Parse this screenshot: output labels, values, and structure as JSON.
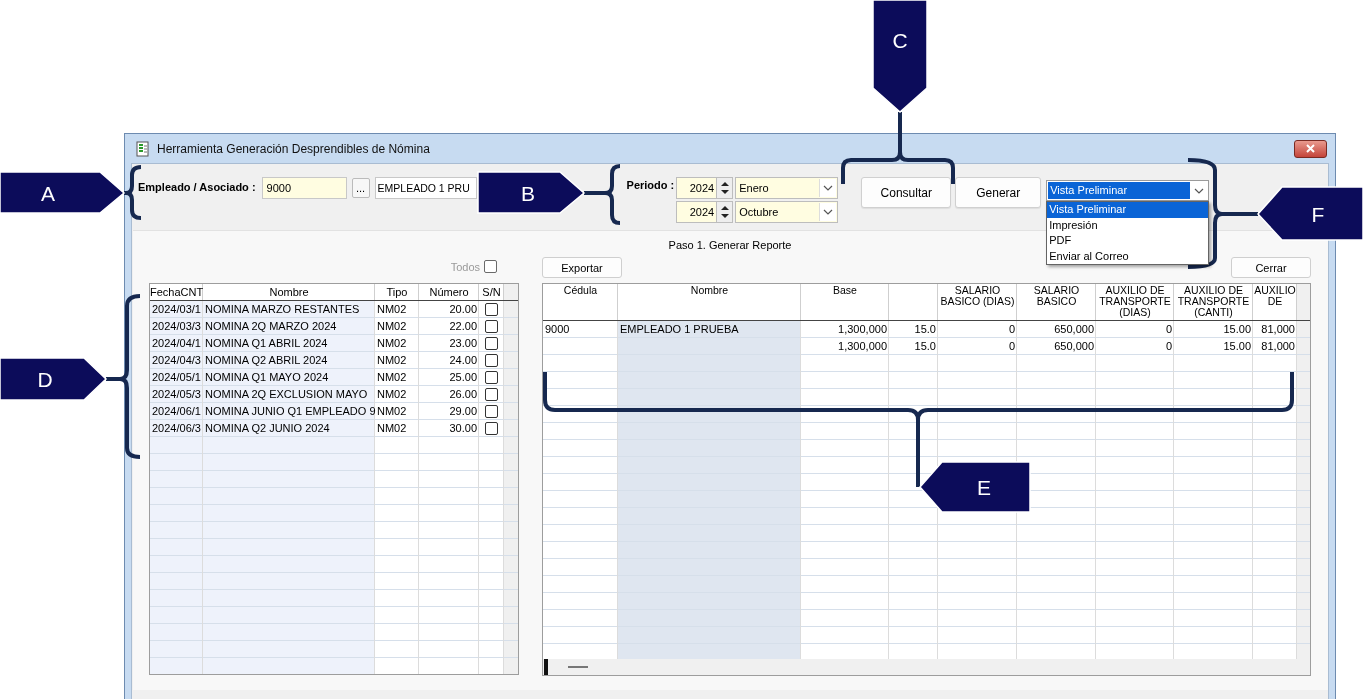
{
  "window": {
    "title": "Herramienta Generación Desprendibles de Nómina"
  },
  "employee": {
    "label": "Empleado / Asociado :",
    "code": "9000",
    "browse": "...",
    "name": "EMPLEADO 1 PRU"
  },
  "period": {
    "label": "Periodo :",
    "ranges": [
      {
        "year": "2024",
        "month": "Enero"
      },
      {
        "year": "2024",
        "month": "Octubre"
      }
    ]
  },
  "actions": [
    "Consultar",
    "Generar"
  ],
  "output": {
    "value": "Vista Preliminar",
    "expanded": true,
    "options": [
      {
        "label": "Vista Preliminar",
        "selected": true
      },
      {
        "label": "Impresión",
        "selected": false
      },
      {
        "label": "PDF",
        "selected": false
      },
      {
        "label": "Enviar al Correo",
        "selected": false
      }
    ]
  },
  "step_title": "Paso 1. Generar Reporte",
  "select_all": {
    "label": "Todos",
    "checked": false,
    "disabled": true
  },
  "export_button": "Exportar",
  "close_button": "Cerrar",
  "payrolls": {
    "columns": [
      {
        "label": "FechaCNT",
        "kind": "text"
      },
      {
        "label": "Nombre",
        "kind": "text"
      },
      {
        "label": "Tipo",
        "kind": "text"
      },
      {
        "label": "Número",
        "kind": "number"
      },
      {
        "label": "S/N",
        "kind": "check"
      }
    ],
    "rows": [
      {
        "cells": [
          "2024/03/1",
          "NOMINA MARZO RESTANTES",
          "NM02",
          "20.00"
        ],
        "checked": false
      },
      {
        "cells": [
          "2024/03/3",
          "NOMINA 2Q MARZO 2024",
          "NM02",
          "22.00"
        ],
        "checked": false
      },
      {
        "cells": [
          "2024/04/1",
          "NOMINA Q1 ABRIL 2024",
          "NM02",
          "23.00"
        ],
        "checked": false
      },
      {
        "cells": [
          "2024/04/3",
          "NOMINA Q2 ABRIL 2024",
          "NM02",
          "24.00"
        ],
        "checked": false
      },
      {
        "cells": [
          "2024/05/1",
          "NOMINA Q1 MAYO 2024",
          "NM02",
          "25.00"
        ],
        "checked": false
      },
      {
        "cells": [
          "2024/05/3",
          "NOMINA 2Q EXCLUSION MAYO",
          "NM02",
          "26.00"
        ],
        "checked": false
      },
      {
        "cells": [
          "2024/06/1",
          "NOMINA JUNIO Q1 EMPLEADO 9",
          "NM02",
          "29.00"
        ],
        "checked": false
      },
      {
        "cells": [
          "2024/06/3",
          "NOMINA Q2 JUNIO 2024",
          "NM02",
          "30.00"
        ],
        "checked": false
      }
    ]
  },
  "report": {
    "columns": [
      {
        "label": "Cédula",
        "kind": "text"
      },
      {
        "label": "Nombre",
        "kind": "text"
      },
      {
        "label": "Base",
        "kind": "number"
      },
      {
        "kind": "number"
      },
      {
        "label": "SALARIO BASICO (DIAS)",
        "kind": "number"
      },
      {
        "label": "SALARIO BASICO",
        "kind": "number"
      },
      {
        "label": "AUXILIO DE TRANSPORTE (DIAS)",
        "kind": "number"
      },
      {
        "label": "AUXILIO DE TRANSPORTE (CANTI)",
        "kind": "number"
      },
      {
        "label": "AUXILIO DE",
        "kind": "number"
      }
    ],
    "rows": [
      {
        "cells": [
          "9000",
          "EMPLEADO 1 PRUEBA",
          "1,300,000",
          "15.0",
          "0",
          "650,000",
          "0",
          "15.00",
          "81,000"
        ]
      },
      {
        "cells": [
          null,
          null,
          "1,300,000",
          "15.0",
          "0",
          "650,000",
          "0",
          "15.00",
          "81,000"
        ]
      }
    ]
  },
  "callouts": [
    {
      "letter": "A"
    },
    {
      "letter": "B"
    },
    {
      "letter": "C"
    },
    {
      "letter": "D"
    },
    {
      "letter": "E"
    },
    {
      "letter": "F"
    }
  ]
}
